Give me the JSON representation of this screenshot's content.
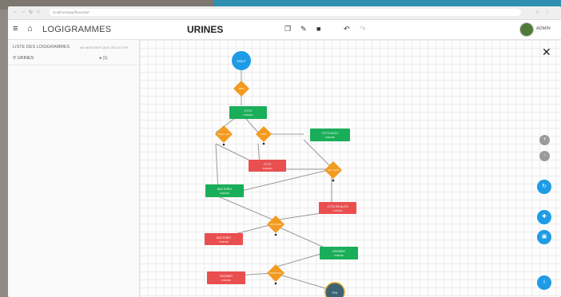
{
  "browser": {
    "url": "localhost/app/flowchart"
  },
  "app": {
    "brand": "LOGIGRAMMES",
    "title": "URINES",
    "user": "ADMIN"
  },
  "sidebar": {
    "header": "LISTE DES LOGIGRAMMES",
    "filter": "NE MONTRER QUE LES ACTIFS",
    "items": [
      {
        "label": "URINES",
        "count": "(1)"
      }
    ]
  },
  "flow": {
    "start": "DEBUT",
    "end": "FIN",
    "decisions": [
      "BOU",
      "SANG + LEU",
      "NITR",
      "LEU + NITR",
      "PAS B NITR",
      "PAS B CYTO"
    ],
    "boxes": [
      {
        "title": "CYTO",
        "sub": "5 MIN BU"
      },
      {
        "title": "CYTO AUTO",
        "sub": "5 MIN BU"
      },
      {
        "title": "CYTO",
        "sub": "5 MIN BU"
      },
      {
        "title": "BACTERIO",
        "sub": "5 MIN BU"
      },
      {
        "title": "CYTO RE AUTO",
        "sub": "5 MIN BU"
      },
      {
        "title": "BACTERIO",
        "sub": "5 MIN BU"
      },
      {
        "title": "DOSSIER",
        "sub": "5 MIN BU"
      },
      {
        "title": "DOSSIER",
        "sub": "5 MIN BU"
      }
    ]
  },
  "icons": {
    "menu": "menu-icon",
    "home": "home-icon",
    "copy": "copy-icon",
    "edit": "pencil-icon",
    "delete": "trash-icon",
    "undo": "undo-icon",
    "redo": "redo-icon",
    "close": "close-icon"
  },
  "colors": {
    "green": "#1aae5a",
    "red": "#ea4f4f",
    "orange": "#f29b1f",
    "blue": "#1e9be6",
    "end": "#3d6276"
  }
}
